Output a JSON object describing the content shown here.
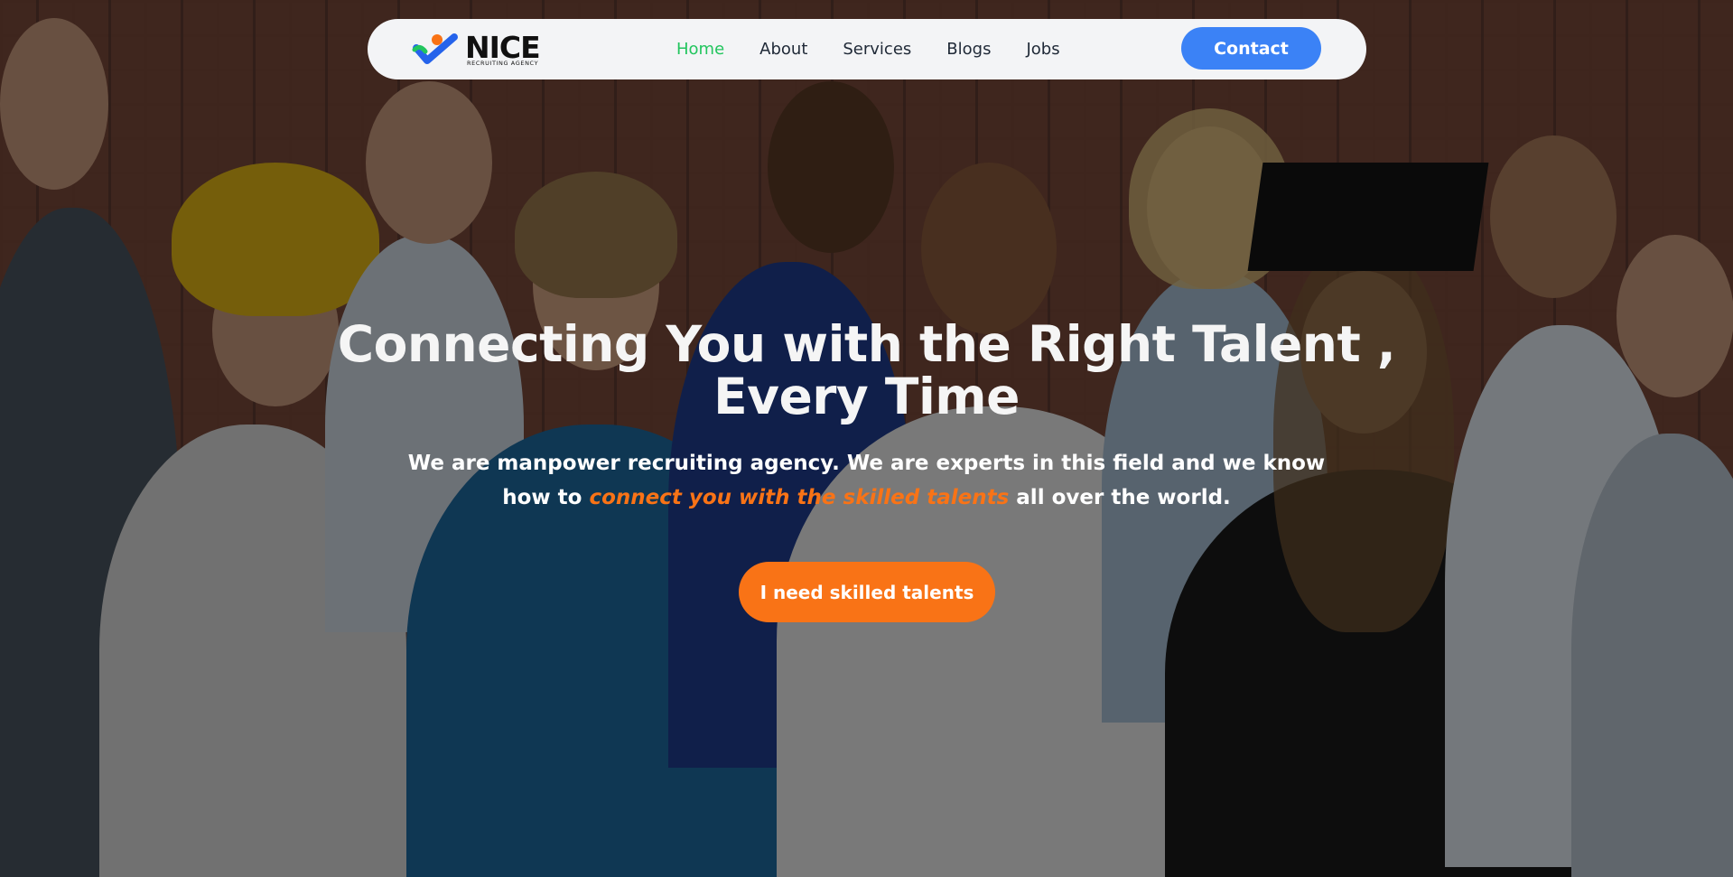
{
  "brand": {
    "name": "NICE",
    "tagline": "RECRUITING AGENCY",
    "colors": {
      "check_blue": "#2563eb",
      "check_green": "#22c55e",
      "dot_orange": "#f97316"
    }
  },
  "nav": {
    "items": [
      {
        "label": "Home",
        "active": true
      },
      {
        "label": "About",
        "active": false
      },
      {
        "label": "Services",
        "active": false
      },
      {
        "label": "Blogs",
        "active": false
      },
      {
        "label": "Jobs",
        "active": false
      }
    ],
    "contact_label": "Contact"
  },
  "hero": {
    "title_line1": "Connecting You with the Right Talent ,",
    "title_line2": "Every Time",
    "subtitle_part1": "We are manpower recruiting agency. We are experts in this field and we know",
    "subtitle_part2": "how to ",
    "subtitle_highlight": "connect you with the skilled talents",
    "subtitle_part3": " all over the world.",
    "cta_label": "I need skilled talents"
  },
  "colors": {
    "accent_orange": "#f97316",
    "active_nav": "#22c55e",
    "contact_blue": "#3b82f6"
  }
}
